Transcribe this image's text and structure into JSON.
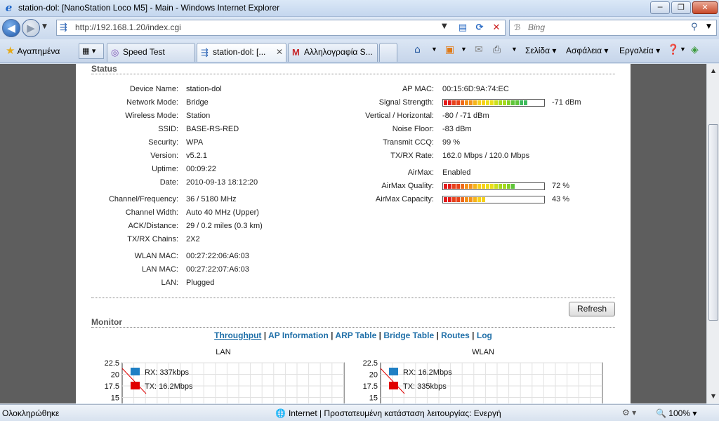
{
  "window": {
    "title": "station-dol: [NanoStation Loco M5] - Main - Windows Internet Explorer",
    "buttons": {
      "minimize": "─",
      "maximize": "❐",
      "close": "✕"
    }
  },
  "address": {
    "url": "http://192.168.1.20/index.cgi"
  },
  "search": {
    "placeholder": "Bing"
  },
  "favorites": {
    "label": "Αγαπημένα"
  },
  "tabs": [
    {
      "label": "Speed Test"
    },
    {
      "label": "station-dol: [..."
    },
    {
      "label": "Αλληλογραφία S..."
    }
  ],
  "commandbar": {
    "page": "Σελίδα",
    "safety": "Ασφάλεια",
    "tools": "Εργαλεία"
  },
  "status_section": {
    "title": "Status",
    "left": [
      {
        "label": "Device Name:",
        "value": "station-dol"
      },
      {
        "label": "Network Mode:",
        "value": "Bridge"
      },
      {
        "label": "Wireless Mode:",
        "value": "Station"
      },
      {
        "label": "SSID:",
        "value": "BASE-RS-RED"
      },
      {
        "label": "Security:",
        "value": "WPA"
      },
      {
        "label": "Version:",
        "value": "v5.2.1"
      },
      {
        "label": "Uptime:",
        "value": "00:09:22"
      },
      {
        "label": "Date:",
        "value": "2010-09-13 18:12:20"
      },
      {
        "label": "Channel/Frequency:",
        "value": "36  /  5180 MHz"
      },
      {
        "label": "Channel Width:",
        "value": "Auto 40 MHz  (Upper)"
      },
      {
        "label": "ACK/Distance:",
        "value": "29 / 0.2 miles (0.3 km)"
      },
      {
        "label": "TX/RX Chains:",
        "value": "2X2"
      },
      {
        "label": "WLAN MAC:",
        "value": "00:27:22:06:A6:03"
      },
      {
        "label": "LAN MAC:",
        "value": "00:27:22:07:A6:03"
      },
      {
        "label": "LAN:",
        "value": "Plugged"
      }
    ],
    "right": [
      {
        "label": "AP MAC:",
        "value": "00:15:6D:9A:74:EC"
      },
      {
        "label": "Signal Strength:",
        "value": "-71 dBm"
      },
      {
        "label": "Vertical / Horizontal:",
        "value": "-80  /  -71  dBm"
      },
      {
        "label": "Noise Floor:",
        "value": "-83 dBm"
      },
      {
        "label": "Transmit CCQ:",
        "value": "99 %"
      },
      {
        "label": "TX/RX Rate:",
        "value": "162.0 Mbps  /  120.0 Mbps"
      },
      {
        "label": "AirMax:",
        "value": "Enabled"
      },
      {
        "label": "AirMax Quality:",
        "value": "72  %"
      },
      {
        "label": "AirMax Capacity:",
        "value": "43  %"
      }
    ],
    "meters": {
      "signal": 0.82,
      "airmax_quality": 0.72,
      "airmax_capacity": 0.43
    }
  },
  "refresh_label": "Refresh",
  "monitor": {
    "title": "Monitor",
    "links": [
      "Throughput",
      "AP Information",
      "ARP Table",
      "Bridge Table",
      "Routes",
      "Log"
    ],
    "separator": " | "
  },
  "chart_data": [
    {
      "type": "line",
      "title": "LAN",
      "yticks": [
        "22.5",
        "20",
        "17.5",
        "15"
      ],
      "ylim": [
        15,
        22.5
      ],
      "legend": [
        {
          "name": "RX: 337kbps",
          "color": "#1f7fc4"
        },
        {
          "name": "TX: 16.2Mbps",
          "color": "#e00000"
        }
      ]
    },
    {
      "type": "line",
      "title": "WLAN",
      "yticks": [
        "22.5",
        "20",
        "17.5",
        "15"
      ],
      "ylim": [
        15,
        22.5
      ],
      "legend": [
        {
          "name": "RX: 16.2Mbps",
          "color": "#1f7fc4"
        },
        {
          "name": "TX: 335kbps",
          "color": "#e00000"
        }
      ]
    }
  ],
  "statusbar": {
    "text": "Ολοκληρώθηκε",
    "zone": "Internet | Προστατευμένη κατάσταση λειτουργίας: Ενεργή",
    "zoom": "100%"
  }
}
